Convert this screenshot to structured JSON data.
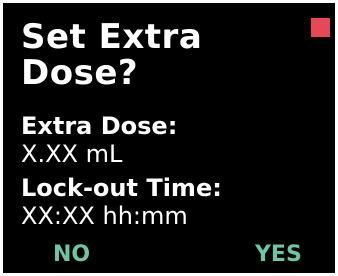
{
  "screen": {
    "title": "Set Extra\nDose?",
    "extra_dose_label": "Extra Dose:",
    "extra_dose_value": "X.XX mL",
    "lockout_label": "Lock-out Time:",
    "lockout_value": "XX:XX hh:mm"
  },
  "softkeys": {
    "left_label": "NO",
    "right_label": "YES"
  },
  "colors": {
    "background": "#000000",
    "text": "#ffffff",
    "softkey": "#6ec5a1",
    "status_indicator": "#e84855"
  }
}
